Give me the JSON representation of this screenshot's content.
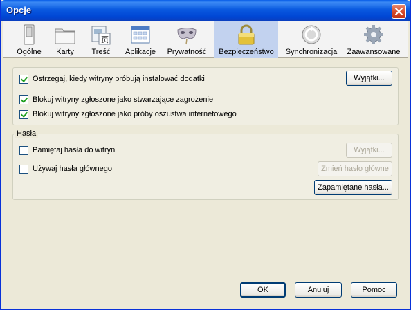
{
  "window": {
    "title": "Opcje"
  },
  "tabs": [
    {
      "label": "Ogólne",
      "icon": "switch-icon"
    },
    {
      "label": "Karty",
      "icon": "folder-tabs-icon"
    },
    {
      "label": "Treść",
      "icon": "content-icon"
    },
    {
      "label": "Aplikacje",
      "icon": "applications-icon"
    },
    {
      "label": "Prywatność",
      "icon": "mask-icon"
    },
    {
      "label": "Bezpieczeństwo",
      "icon": "padlock-icon",
      "selected": true
    },
    {
      "label": "Synchronizacja",
      "icon": "sync-icon"
    },
    {
      "label": "Zaawansowane",
      "icon": "gear-icon"
    }
  ],
  "security": {
    "warn_addons": {
      "label": "Ostrzegaj, kiedy witryny próbują instalować dodatki",
      "checked": true
    },
    "exceptions_button": "Wyjątki...",
    "block_attack": {
      "label": "Blokuj witryny zgłoszone jako stwarzające zagrożenie",
      "checked": true
    },
    "block_forgery": {
      "label": "Blokuj witryny zgłoszone jako próby oszustwa internetowego",
      "checked": true
    }
  },
  "passwords": {
    "title": "Hasła",
    "remember": {
      "label": "Pamiętaj hasła do witryn",
      "checked": false
    },
    "exceptions_button": "Wyjątki...",
    "master": {
      "label": "Używaj hasła głównego",
      "checked": false
    },
    "change_master_button": "Zmień hasło główne",
    "saved_button": "Zapamiętane hasła..."
  },
  "footer": {
    "ok": "OK",
    "cancel": "Anuluj",
    "help": "Pomoc"
  }
}
